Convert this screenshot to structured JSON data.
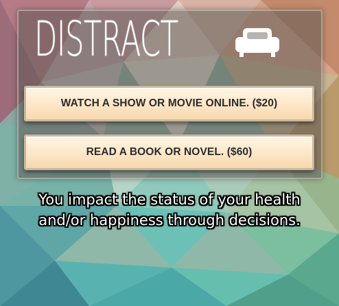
{
  "app": {
    "title": "DISTRACT",
    "title_icon": "sofa-icon"
  },
  "choices": [
    {
      "label": "WATCH A SHOW OR MOVIE ONLINE. ($20)"
    },
    {
      "label": "READ A BOOK OR NOVEL. ($60)"
    }
  ],
  "caption": {
    "line1": "You impact the status of your health",
    "line2": "and/or happiness through decisions."
  },
  "colors": {
    "button_fill": "#fde9cc",
    "button_text": "#2b2b2b",
    "title_text": "#ffffff",
    "caption_text": "#ffffff",
    "caption_outline": "#000000"
  }
}
